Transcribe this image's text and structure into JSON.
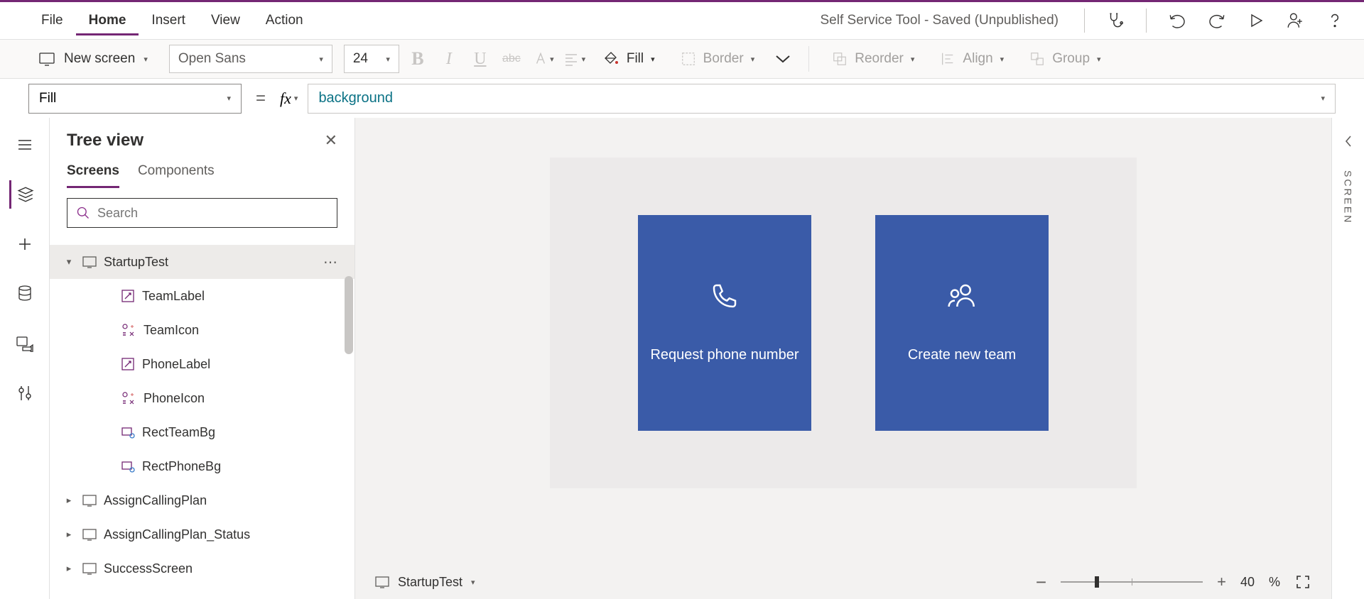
{
  "menu": {
    "file": "File",
    "home": "Home",
    "insert": "Insert",
    "view": "View",
    "action": "Action"
  },
  "title": "Self Service Tool - Saved (Unpublished)",
  "ribbon": {
    "new_screen": "New screen",
    "font": "Open Sans",
    "size": "24",
    "fill": "Fill",
    "border": "Border",
    "reorder": "Reorder",
    "align": "Align",
    "group": "Group"
  },
  "formula": {
    "property": "Fill",
    "value": "background"
  },
  "panel": {
    "title": "Tree view",
    "tab_screens": "Screens",
    "tab_components": "Components",
    "search_placeholder": "Search",
    "items": [
      {
        "name": "StartupTest",
        "type": "screen",
        "expanded": true,
        "selected": true
      },
      {
        "name": "TeamLabel",
        "type": "label"
      },
      {
        "name": "TeamIcon",
        "type": "icon"
      },
      {
        "name": "PhoneLabel",
        "type": "label"
      },
      {
        "name": "PhoneIcon",
        "type": "icon"
      },
      {
        "name": "RectTeamBg",
        "type": "rect"
      },
      {
        "name": "RectPhoneBg",
        "type": "rect"
      },
      {
        "name": "AssignCallingPlan",
        "type": "screen"
      },
      {
        "name": "AssignCallingPlan_Status",
        "type": "screen"
      },
      {
        "name": "SuccessScreen",
        "type": "screen"
      }
    ]
  },
  "canvas": {
    "tile1": "Request phone number",
    "tile2": "Create new team"
  },
  "status": {
    "screen": "StartupTest",
    "zoom": "40",
    "zoom_unit": "%"
  },
  "rightrail": "SCREEN"
}
